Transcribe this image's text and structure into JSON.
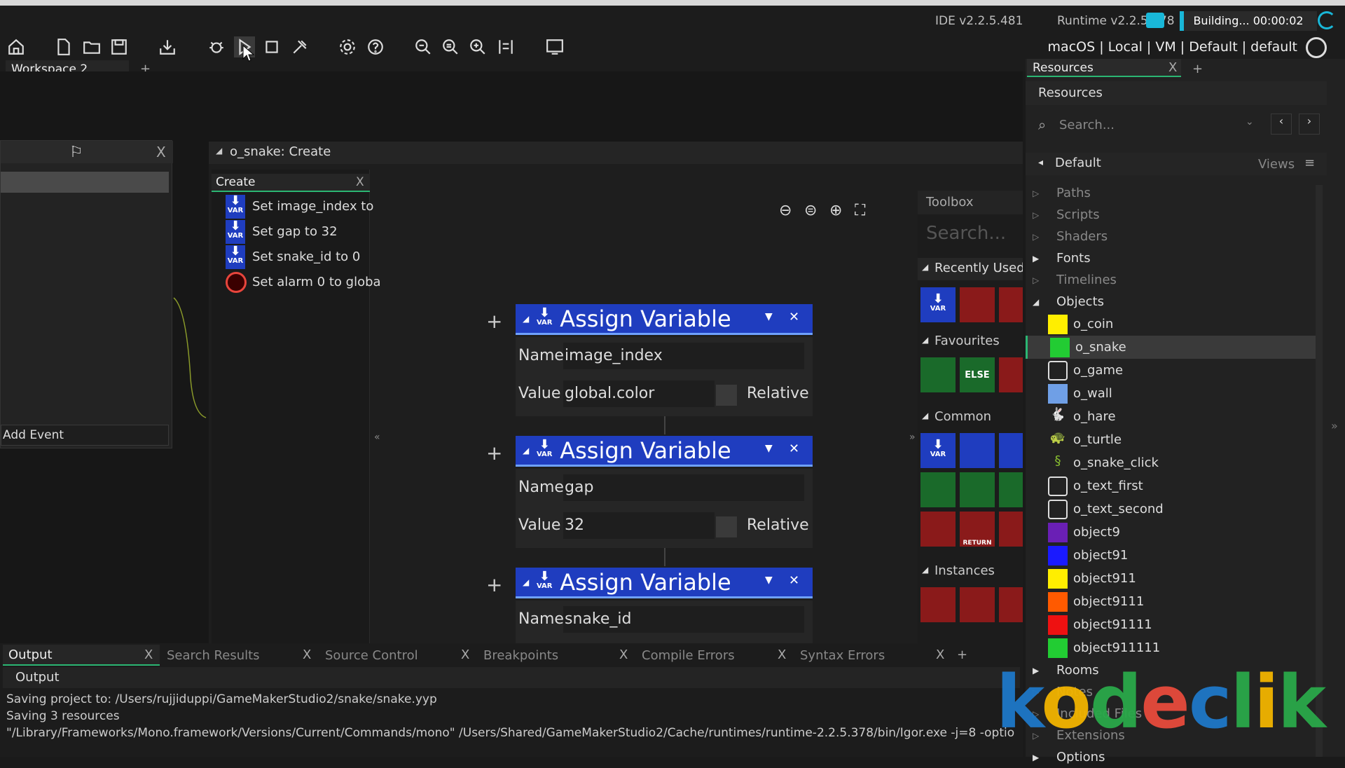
{
  "header": {
    "ide_version": "IDE v2.2.5.481",
    "runtime_version": "Runtime v2.2.5.378",
    "build_status": "Building... 00:00:02",
    "platform": "macOS | Local | VM | Default | default"
  },
  "workspace": {
    "tab_label": "Workspace 2",
    "add_tab": "+"
  },
  "object_panel": {
    "add_event_label": "Add Event",
    "close_label": "X"
  },
  "event_window": {
    "title": "o_snake: Create",
    "list_tab": "Create",
    "list_items": [
      {
        "text": "Set image_index to",
        "icon": "var-icon"
      },
      {
        "text": "Set gap to 32",
        "icon": "var-icon"
      },
      {
        "text": "Set snake_id to 0",
        "icon": "var-icon"
      },
      {
        "text": "Set alarm 0 to globa",
        "icon": "alarm-icon"
      }
    ]
  },
  "blocks": [
    {
      "title": "Assign Variable",
      "name_label": "Name",
      "name_value": "image_index",
      "value_label": "Value",
      "value_value": "global.color",
      "relative_label": "Relative"
    },
    {
      "title": "Assign Variable",
      "name_label": "Name",
      "name_value": "gap",
      "value_label": "Value",
      "value_value": "32",
      "relative_label": "Relative"
    },
    {
      "title": "Assign Variable",
      "name_label": "Name",
      "name_value": "snake_id"
    }
  ],
  "toolbox": {
    "title": "Toolbox",
    "search_placeholder": "Search...",
    "sections": [
      "Recently Used",
      "Favourites",
      "Common",
      "Instances"
    ],
    "else_label": "ELSE",
    "return_label": "RETURN",
    "var_label": "VAR"
  },
  "resources": {
    "tab_label": "Resources",
    "header": "Resources",
    "search_placeholder": "Search...",
    "group": "Default",
    "views_label": "Views",
    "folders_top": [
      "Paths",
      "Scripts",
      "Shaders",
      "Fonts",
      "Timelines",
      "Objects"
    ],
    "objects": [
      {
        "name": "o_coin",
        "color": "#ffee00"
      },
      {
        "name": "o_snake",
        "color": "#22cc33"
      },
      {
        "name": "o_game",
        "color": "none"
      },
      {
        "name": "o_wall",
        "color": "#6f9fe6"
      },
      {
        "name": "o_hare",
        "color": "sprite"
      },
      {
        "name": "o_turtle",
        "color": "sprite"
      },
      {
        "name": "o_snake_click",
        "color": "sprite"
      },
      {
        "name": "o_text_first",
        "color": "none"
      },
      {
        "name": "o_text_second",
        "color": "none"
      },
      {
        "name": "object9",
        "color": "#6a1fb5"
      },
      {
        "name": "object91",
        "color": "#1a1aff"
      },
      {
        "name": "object911",
        "color": "#ffee00"
      },
      {
        "name": "object9111",
        "color": "#ff5a00"
      },
      {
        "name": "object91111",
        "color": "#ee1111"
      },
      {
        "name": "object911111",
        "color": "#22cc33"
      }
    ],
    "folders_bottom": [
      "Rooms",
      "Notes",
      "Included Files",
      "Extensions",
      "Options"
    ]
  },
  "output": {
    "tabs": [
      "Output",
      "Search Results",
      "Source Control",
      "Breakpoints",
      "Compile Errors",
      "Syntax Errors"
    ],
    "header": "Output",
    "lines": [
      "Saving project to: /Users/rujjiduppi/GameMakerStudio2/snake/snake.yyp",
      "Saving 3 resources",
      "\"/Library/Frameworks/Mono.framework/Versions/Current/Commands/mono\"  /Users/Shared/GameMakerStudio2/Cache/runtimes/runtime-2.2.5.378/bin/Igor.exe -j=8 -optio"
    ]
  },
  "watermark": "kodeclik"
}
